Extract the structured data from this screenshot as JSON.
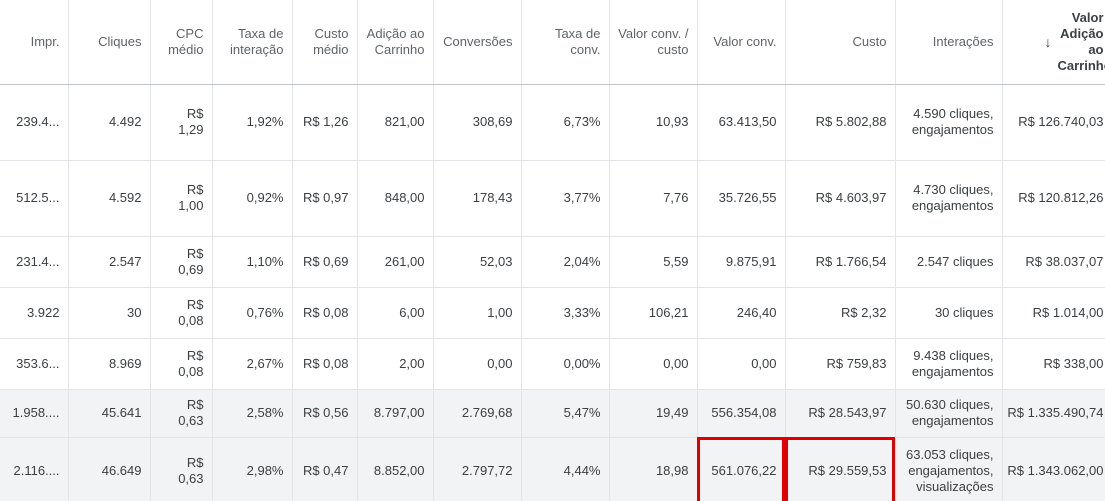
{
  "headers": [
    {
      "label": "Impr."
    },
    {
      "label": "Cliques"
    },
    {
      "label": "CPC médio"
    },
    {
      "label": "Taxa de interação"
    },
    {
      "label": "Custo médio"
    },
    {
      "label": "Adição ao Carrinho"
    },
    {
      "label": "Conversões"
    },
    {
      "label": "Taxa de conv."
    },
    {
      "label": "Valor conv. / custo"
    },
    {
      "label": "Valor conv."
    },
    {
      "label": "Custo"
    },
    {
      "label": "Interações"
    },
    {
      "label": "Valor Adição ao Carrinho",
      "sorted": "desc"
    }
  ],
  "rows": [
    [
      "239.4...",
      "4.492",
      "R$ 1,29",
      "1,92%",
      "R$ 1,26",
      "821,00",
      "308,69",
      "6,73%",
      "10,93",
      "63.413,50",
      "R$ 5.802,88",
      "4.590 cliques, engajamentos",
      "R$ 126.740,03"
    ],
    [
      "512.5...",
      "4.592",
      "R$ 1,00",
      "0,92%",
      "R$ 0,97",
      "848,00",
      "178,43",
      "3,77%",
      "7,76",
      "35.726,55",
      "R$ 4.603,97",
      "4.730 cliques, engajamentos",
      "R$ 120.812,26"
    ],
    [
      "231.4...",
      "2.547",
      "R$ 0,69",
      "1,10%",
      "R$ 0,69",
      "261,00",
      "52,03",
      "2,04%",
      "5,59",
      "9.875,91",
      "R$ 1.766,54",
      "2.547 cliques",
      "R$ 38.037,07"
    ],
    [
      "3.922",
      "30",
      "R$ 0,08",
      "0,76%",
      "R$ 0,08",
      "6,00",
      "1,00",
      "3,33%",
      "106,21",
      "246,40",
      "R$ 2,32",
      "30 cliques",
      "R$ 1.014,00"
    ],
    [
      "353.6...",
      "8.969",
      "R$ 0,08",
      "2,67%",
      "R$ 0,08",
      "2,00",
      "0,00",
      "0,00%",
      "0,00",
      "0,00",
      "R$ 759,83",
      "9.438 cliques, engajamentos",
      "R$ 338,00"
    ]
  ],
  "totals": [
    [
      "1.958....",
      "45.641",
      "R$ 0,63",
      "2,58%",
      "R$ 0,56",
      "8.797,00",
      "2.769,68",
      "5,47%",
      "19,49",
      "556.354,08",
      "R$ 28.543,97",
      "50.630 cliques, engajamentos",
      "R$ 1.335.490,74"
    ],
    [
      "2.116....",
      "46.649",
      "R$ 0,63",
      "2,98%",
      "R$ 0,47",
      "8.852,00",
      "2.797,72",
      "4,44%",
      "18,98",
      "561.076,22",
      "R$ 29.559,53",
      "63.053 cliques, engajamentos, visualizações",
      "R$ 1.343.062,00"
    ]
  ],
  "sort_icon": "arrow-down-icon",
  "highlight_color": "#e00000"
}
